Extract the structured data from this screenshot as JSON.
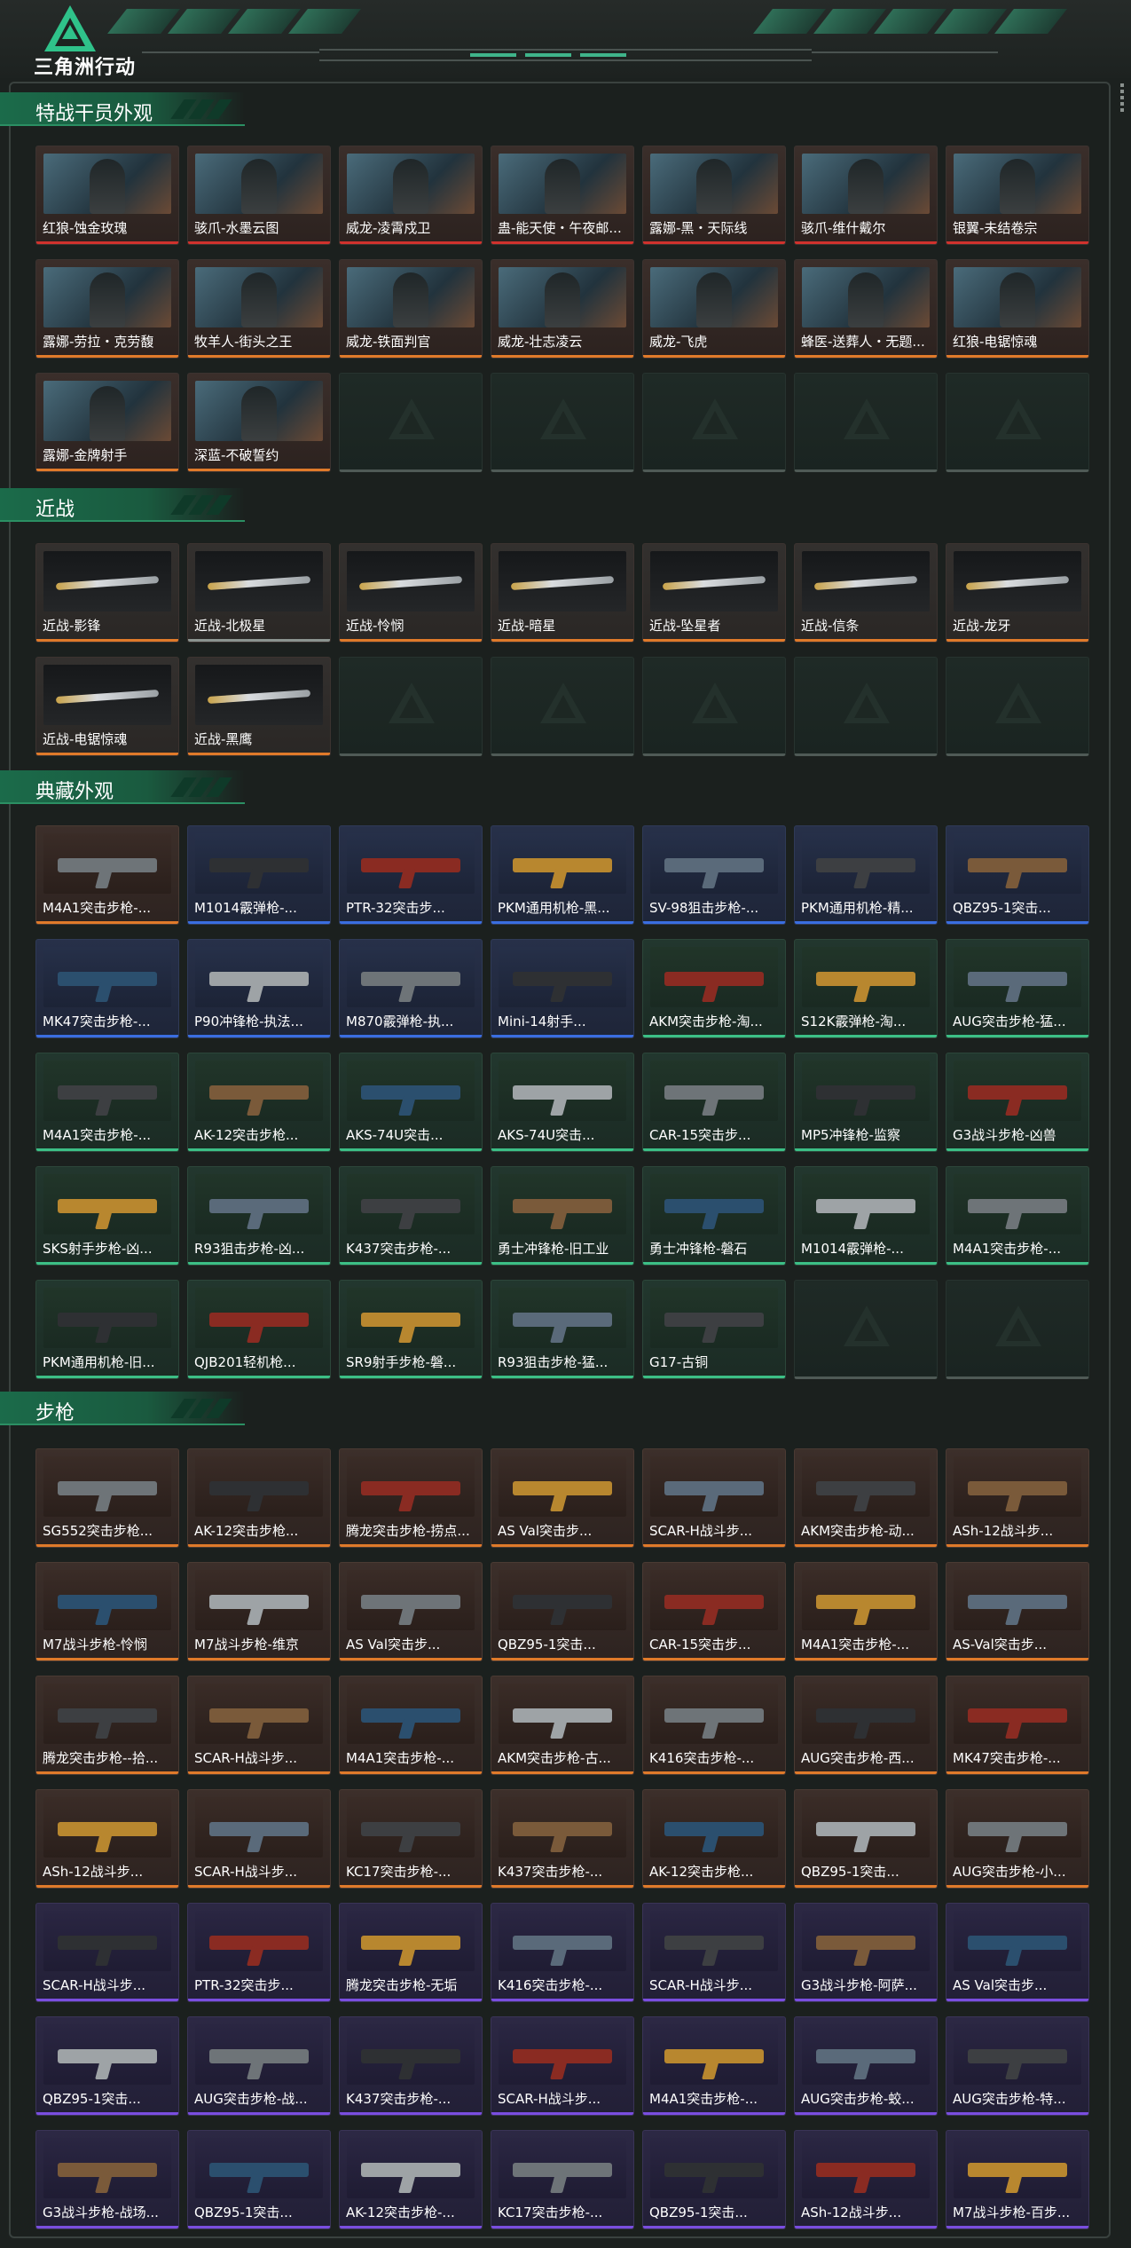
{
  "app": {
    "logo_text": "三角洲行动"
  },
  "sections": {
    "agents": {
      "title": "特战干员外观",
      "items": [
        {
          "label": "红狼-蚀金玫瑰",
          "rarity": "red"
        },
        {
          "label": "骇爪-水墨云图",
          "rarity": "red"
        },
        {
          "label": "威龙-凌霄戍卫",
          "rarity": "red"
        },
        {
          "label": "蛊-能天使・午夜邮...",
          "rarity": "red"
        },
        {
          "label": "露娜-黑・天际线",
          "rarity": "red"
        },
        {
          "label": "骇爪-维什戴尔",
          "rarity": "red"
        },
        {
          "label": "银翼-未结卷宗",
          "rarity": "red"
        },
        {
          "label": "露娜-劳拉・克劳馥",
          "rarity": "orange"
        },
        {
          "label": "牧羊人-街头之王",
          "rarity": "orange"
        },
        {
          "label": "威龙-铁面判官",
          "rarity": "orange"
        },
        {
          "label": "威龙-壮志凌云",
          "rarity": "orange"
        },
        {
          "label": "威龙-飞虎",
          "rarity": "orange"
        },
        {
          "label": "蜂医-送葬人・无题...",
          "rarity": "orange"
        },
        {
          "label": "红狼-电锯惊魂",
          "rarity": "orange"
        },
        {
          "label": "露娜-金牌射手",
          "rarity": "orange"
        },
        {
          "label": "深蓝-不破誓约",
          "rarity": "orange"
        }
      ]
    },
    "melee": {
      "title": "近战",
      "items": [
        {
          "label": "近战-影锋",
          "rarity": "orange"
        },
        {
          "label": "近战-北极星",
          "rarity": "gray"
        },
        {
          "label": "近战-怜悯",
          "rarity": "orange"
        },
        {
          "label": "近战-暗星",
          "rarity": "orange"
        },
        {
          "label": "近战-坠星者",
          "rarity": "orange"
        },
        {
          "label": "近战-信条",
          "rarity": "orange"
        },
        {
          "label": "近战-龙牙",
          "rarity": "orange"
        },
        {
          "label": "近战-电锯惊魂",
          "rarity": "orange"
        },
        {
          "label": "近战-黑鹰",
          "rarity": "orange"
        }
      ]
    },
    "collection": {
      "title": "典藏外观",
      "items": [
        {
          "label": "M4A1突击步枪-...",
          "rarity": "gold"
        },
        {
          "label": "M1014霰弹枪-...",
          "rarity": "blue"
        },
        {
          "label": "PTR-32突击步...",
          "rarity": "blue"
        },
        {
          "label": "PKM通用机枪-黑...",
          "rarity": "blue"
        },
        {
          "label": "SV-98狙击步枪-...",
          "rarity": "blue"
        },
        {
          "label": "PKM通用机枪-精...",
          "rarity": "blue"
        },
        {
          "label": "QBZ95-1突击...",
          "rarity": "blue"
        },
        {
          "label": "MK47突击步枪-...",
          "rarity": "blue"
        },
        {
          "label": "P90冲锋枪-执法...",
          "rarity": "blue"
        },
        {
          "label": "M870霰弹枪-执...",
          "rarity": "blue"
        },
        {
          "label": "Mini-14射手...",
          "rarity": "blue"
        },
        {
          "label": "AKM突击步枪-淘...",
          "rarity": "green"
        },
        {
          "label": "S12K霰弹枪-淘...",
          "rarity": "green"
        },
        {
          "label": "AUG突击步枪-猛...",
          "rarity": "green"
        },
        {
          "label": "M4A1突击步枪-...",
          "rarity": "green"
        },
        {
          "label": "AK-12突击步枪...",
          "rarity": "green"
        },
        {
          "label": "AKS-74U突击...",
          "rarity": "green"
        },
        {
          "label": "AKS-74U突击...",
          "rarity": "green"
        },
        {
          "label": "CAR-15突击步...",
          "rarity": "green"
        },
        {
          "label": "MP5冲锋枪-监察",
          "rarity": "green"
        },
        {
          "label": "G3战斗步枪-凶兽",
          "rarity": "green"
        },
        {
          "label": "SKS射手步枪-凶...",
          "rarity": "green"
        },
        {
          "label": "R93狙击步枪-凶...",
          "rarity": "green"
        },
        {
          "label": "K437突击步枪-...",
          "rarity": "green"
        },
        {
          "label": "勇士冲锋枪-旧工业",
          "rarity": "green"
        },
        {
          "label": "勇士冲锋枪-磐石",
          "rarity": "green"
        },
        {
          "label": "M1014霰弹枪-...",
          "rarity": "green"
        },
        {
          "label": "M4A1突击步枪-...",
          "rarity": "green"
        },
        {
          "label": "PKM通用机枪-旧...",
          "rarity": "green"
        },
        {
          "label": "QJB201轻机枪...",
          "rarity": "green"
        },
        {
          "label": "SR9射手步枪-磐...",
          "rarity": "green"
        },
        {
          "label": "R93狙击步枪-猛...",
          "rarity": "green"
        },
        {
          "label": "G17-古铜",
          "rarity": "green"
        }
      ]
    },
    "rifles": {
      "title": "步枪",
      "items": [
        {
          "label": "SG552突击步枪...",
          "rarity": "gold"
        },
        {
          "label": "AK-12突击步枪...",
          "rarity": "gold"
        },
        {
          "label": "腾龙突击步枪-捞点...",
          "rarity": "gold"
        },
        {
          "label": "AS Val突击步...",
          "rarity": "gold"
        },
        {
          "label": "SCAR-H战斗步...",
          "rarity": "gold"
        },
        {
          "label": "AKM突击步枪-动...",
          "rarity": "gold"
        },
        {
          "label": "ASh-12战斗步...",
          "rarity": "gold"
        },
        {
          "label": "M7战斗步枪-怜悯",
          "rarity": "gold"
        },
        {
          "label": "M7战斗步枪-维京",
          "rarity": "gold"
        },
        {
          "label": "AS Val突击步...",
          "rarity": "gold"
        },
        {
          "label": "QBZ95-1突击...",
          "rarity": "gold"
        },
        {
          "label": "CAR-15突击步...",
          "rarity": "gold"
        },
        {
          "label": "M4A1突击步枪-...",
          "rarity": "gold"
        },
        {
          "label": "AS-Val突击步...",
          "rarity": "gold"
        },
        {
          "label": "腾龙突击步枪--拾...",
          "rarity": "gold"
        },
        {
          "label": "SCAR-H战斗步...",
          "rarity": "gold"
        },
        {
          "label": "M4A1突击步枪-...",
          "rarity": "gold"
        },
        {
          "label": "AKM突击步枪-古...",
          "rarity": "gold"
        },
        {
          "label": "K416突击步枪-...",
          "rarity": "gold"
        },
        {
          "label": "AUG突击步枪-西...",
          "rarity": "gold"
        },
        {
          "label": "MK47突击步枪-...",
          "rarity": "gold"
        },
        {
          "label": "ASh-12战斗步...",
          "rarity": "gold"
        },
        {
          "label": "SCAR-H战斗步...",
          "rarity": "gold"
        },
        {
          "label": "KC17突击步枪-...",
          "rarity": "gold"
        },
        {
          "label": "K437突击步枪-...",
          "rarity": "gold"
        },
        {
          "label": "AK-12突击步枪...",
          "rarity": "gold"
        },
        {
          "label": "QBZ95-1突击...",
          "rarity": "gold"
        },
        {
          "label": "AUG突击步枪-小...",
          "rarity": "gold"
        },
        {
          "label": "SCAR-H战斗步...",
          "rarity": "purple"
        },
        {
          "label": "PTR-32突击步...",
          "rarity": "purple"
        },
        {
          "label": "腾龙突击步枪-无垢",
          "rarity": "purple"
        },
        {
          "label": "K416突击步枪-...",
          "rarity": "purple"
        },
        {
          "label": "SCAR-H战斗步...",
          "rarity": "purple"
        },
        {
          "label": "G3战斗步枪-阿萨...",
          "rarity": "purple"
        },
        {
          "label": "AS Val突击步...",
          "rarity": "purple"
        },
        {
          "label": "QBZ95-1突击...",
          "rarity": "purple"
        },
        {
          "label": "AUG突击步枪-战...",
          "rarity": "purple"
        },
        {
          "label": "K437突击步枪-...",
          "rarity": "purple"
        },
        {
          "label": "SCAR-H战斗步...",
          "rarity": "purple"
        },
        {
          "label": "M4A1突击步枪-...",
          "rarity": "purple"
        },
        {
          "label": "AUG突击步枪-蛟...",
          "rarity": "purple"
        },
        {
          "label": "AUG突击步枪-特...",
          "rarity": "purple"
        },
        {
          "label": "G3战斗步枪-战场...",
          "rarity": "purple"
        },
        {
          "label": "QBZ95-1突击...",
          "rarity": "purple"
        },
        {
          "label": "AK-12突击步枪-...",
          "rarity": "purple"
        },
        {
          "label": "KC17突击步枪-...",
          "rarity": "purple"
        },
        {
          "label": "QBZ95-1突击...",
          "rarity": "purple"
        },
        {
          "label": "ASh-12战斗步...",
          "rarity": "purple"
        },
        {
          "label": "M7战斗步枪-百步...",
          "rarity": "purple"
        }
      ]
    }
  },
  "colors": {
    "accent_green": "#3cbf86",
    "rarity_red": "#d0322d",
    "rarity_orange": "#e07a2a",
    "rarity_blue": "#3a6ee0",
    "rarity_purple": "#7a4ee0"
  }
}
